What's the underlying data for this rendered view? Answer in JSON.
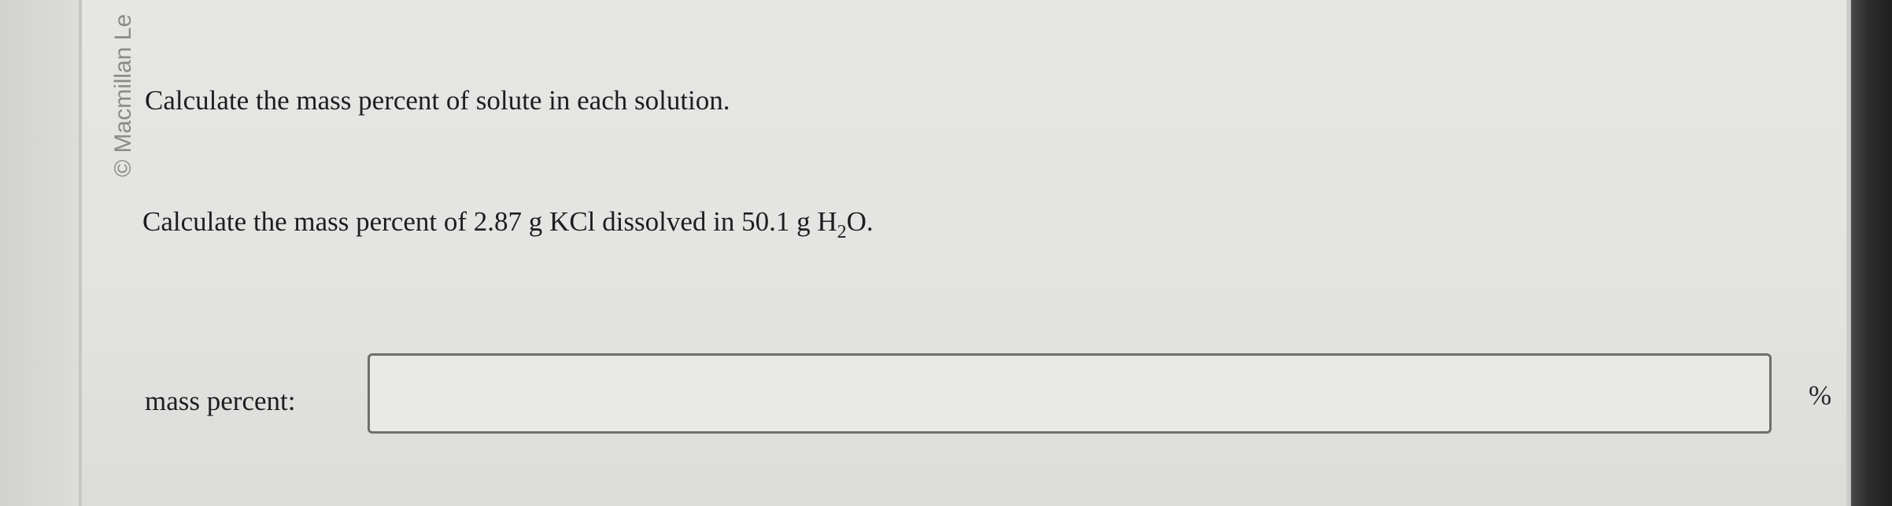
{
  "copyright": "© Macmillan Le",
  "instruction": "Calculate the mass percent of solute in each solution.",
  "question": {
    "prefix": "Calculate the mass percent of 2.87 g KCl dissolved in 50.1 g H",
    "subscript": "2",
    "suffix": "O."
  },
  "answer": {
    "label": "mass percent:",
    "value": "",
    "unit": "%"
  }
}
